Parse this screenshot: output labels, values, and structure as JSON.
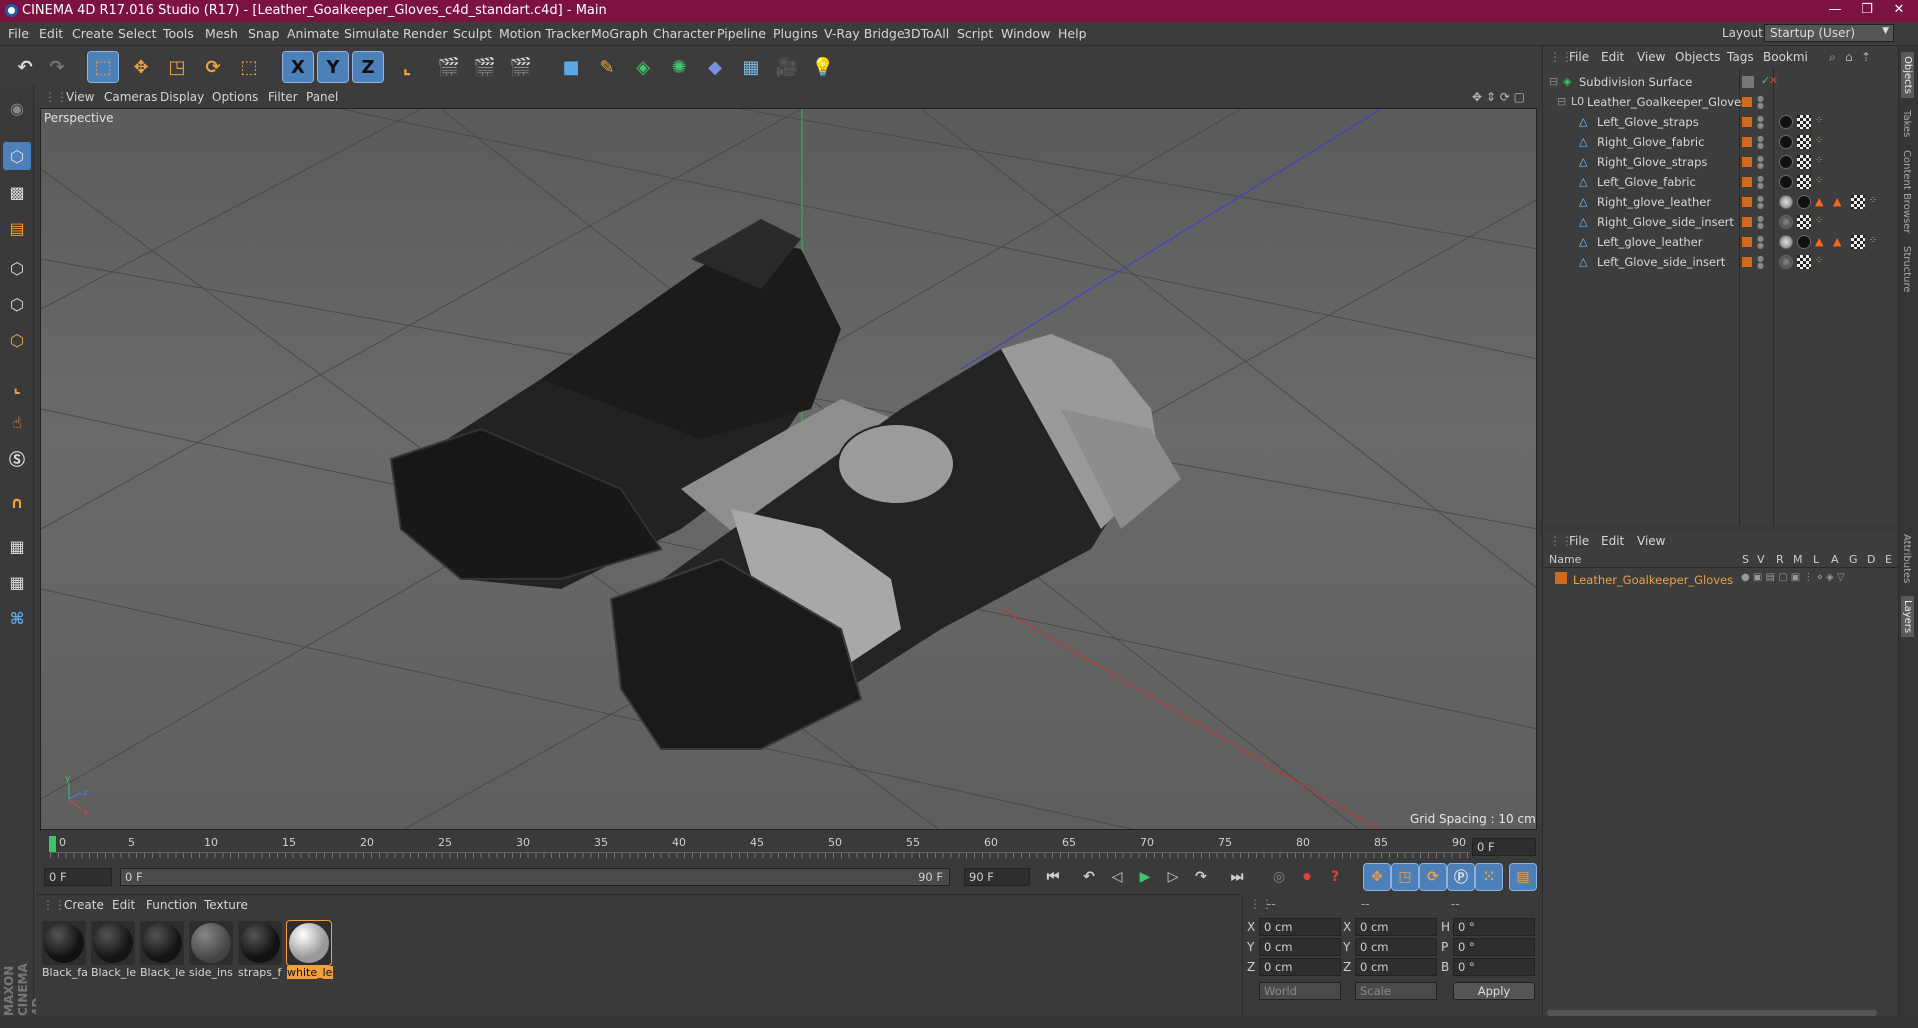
{
  "window": {
    "title": "CINEMA 4D R17.016 Studio (R17) - [Leather_Goalkeeper_Gloves_c4d_standart.c4d] - Main",
    "controls": [
      "—",
      "❐",
      "✕"
    ]
  },
  "menubar": {
    "items": [
      "File",
      "Edit",
      "Create",
      "Select",
      "Tools",
      "Mesh",
      "Snap",
      "Animate",
      "Simulate",
      "Render",
      "Sculpt",
      "Motion Tracker",
      "MoGraph",
      "Character",
      "Pipeline",
      "Plugins",
      "V-Ray Bridge",
      "3DToAll",
      "Script",
      "Window",
      "Help"
    ],
    "layout_label": "Layout:",
    "layout_value": "Startup (User)"
  },
  "toolbar": {
    "axis": [
      "X",
      "Y",
      "Z"
    ]
  },
  "viewport": {
    "menu": [
      "View",
      "Cameras",
      "Display",
      "Options",
      "Filter",
      "Panel"
    ],
    "label": "Perspective",
    "grid_spacing": "Grid Spacing : 10 cm"
  },
  "timeline": {
    "ticks": [
      "0",
      "5",
      "10",
      "15",
      "20",
      "25",
      "30",
      "35",
      "40",
      "45",
      "50",
      "55",
      "60",
      "65",
      "70",
      "75",
      "80",
      "85",
      "90"
    ],
    "current_frame": "0 F",
    "start_field": "0 F",
    "range_start": "0 F",
    "range_end": "90 F",
    "end_field": "90 F"
  },
  "materials": {
    "menu": [
      "Create",
      "Edit",
      "Function",
      "Texture"
    ],
    "items": [
      {
        "label": "Black_fa",
        "color": "#111111"
      },
      {
        "label": "Black_le",
        "color": "#151515"
      },
      {
        "label": "Black_le",
        "color": "#141414"
      },
      {
        "label": "side_ins",
        "color": "#555555"
      },
      {
        "label": "straps_f",
        "color": "#121212"
      },
      {
        "label": "white_le",
        "color": "#bdbdbd",
        "selected": true
      }
    ]
  },
  "coordinates": {
    "headers": [
      "--",
      "--",
      "--"
    ],
    "rows": [
      {
        "a": "X",
        "av": "0 cm",
        "b": "X",
        "bv": "0 cm",
        "c": "H",
        "cv": "0 °"
      },
      {
        "a": "Y",
        "av": "0 cm",
        "b": "Y",
        "bv": "0 cm",
        "c": "P",
        "cv": "0 °"
      },
      {
        "a": "Z",
        "av": "0 cm",
        "b": "Z",
        "bv": "0 cm",
        "c": "B",
        "cv": "0 °"
      }
    ],
    "mode": "World",
    "scale": "Scale",
    "apply": "Apply"
  },
  "objects": {
    "menu": [
      "File",
      "Edit",
      "View",
      "Objects",
      "Tags",
      "Bookmi"
    ],
    "items": [
      {
        "name": "Subdivision Surface",
        "indent": 0,
        "icon": "subdivision-icon",
        "tags": "none"
      },
      {
        "name": "Leather_Goalkeeper_Gloves",
        "indent": 1,
        "icon": "null-icon",
        "tags": "none"
      },
      {
        "name": "Left_Glove_straps",
        "indent": 2,
        "icon": "polygon-icon",
        "tags": "dark"
      },
      {
        "name": "Right_Glove_fabric",
        "indent": 2,
        "icon": "polygon-icon",
        "tags": "dark"
      },
      {
        "name": "Right_Glove_straps",
        "indent": 2,
        "icon": "polygon-icon",
        "tags": "dark"
      },
      {
        "name": "Left_Glove_fabric",
        "indent": 2,
        "icon": "polygon-icon",
        "tags": "dark"
      },
      {
        "name": "Right_glove_leather",
        "indent": 2,
        "icon": "polygon-icon",
        "tags": "multi"
      },
      {
        "name": "Right_Glove_side_insert",
        "indent": 2,
        "icon": "polygon-icon",
        "tags": "grey"
      },
      {
        "name": "Left_glove_leather",
        "indent": 2,
        "icon": "polygon-icon",
        "tags": "multi"
      },
      {
        "name": "Left_Glove_side_insert",
        "indent": 2,
        "icon": "polygon-icon",
        "tags": "grey"
      }
    ]
  },
  "layers": {
    "menu": [
      "File",
      "Edit",
      "View"
    ],
    "columns": [
      "Name",
      "S",
      "V",
      "R",
      "M",
      "L",
      "A",
      "G",
      "D",
      "E"
    ],
    "items": [
      {
        "name": "Leather_Goalkeeper_Gloves"
      }
    ]
  },
  "right_tabs": [
    "Objects",
    "Takes",
    "Content Browser",
    "Structure",
    "Attributes",
    "Layers"
  ],
  "brand": "MAXON CINEMA 4D",
  "colors": {
    "accent": "#d46a1e",
    "titlebar": "#7c1240",
    "selection": "#4d7fb8"
  }
}
